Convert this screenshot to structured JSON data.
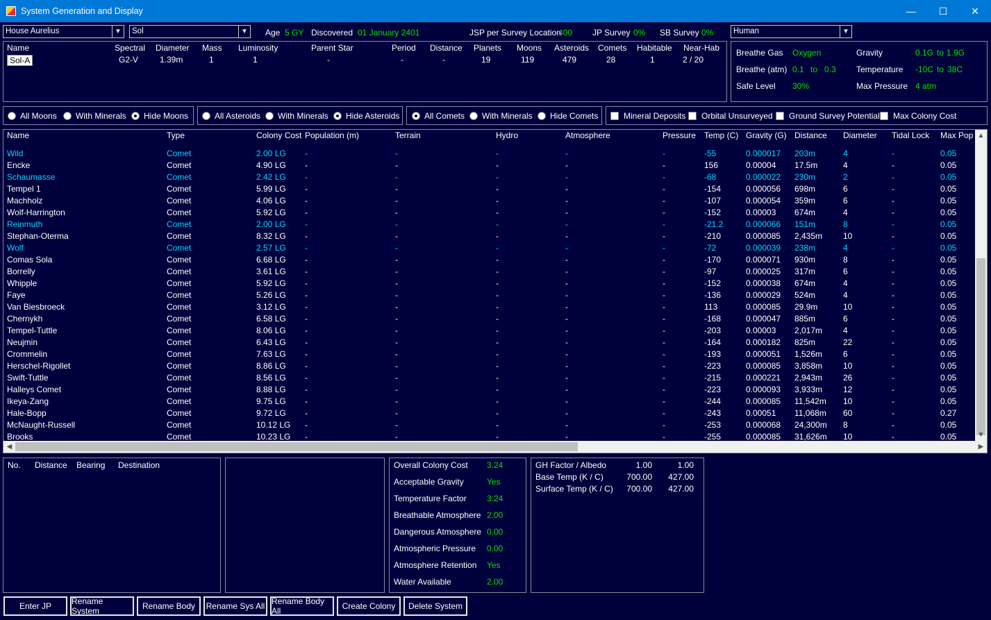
{
  "window": {
    "title": "System Generation and Display",
    "minimize": "—",
    "maximize": "☐",
    "close": "✕"
  },
  "top": {
    "race_select": "House Aurelius",
    "system_select": "Sol",
    "age_label": "Age",
    "age_value": "5 GY",
    "discovered_label": "Discovered",
    "discovered_value": "01 January 2401",
    "jsp_label": "JSP per Survey Location",
    "jsp_value": "400",
    "jp_label": "JP Survey",
    "jp_value": "0%",
    "sb_label": "SB Survey",
    "sb_value": "0%",
    "species_select": "Human"
  },
  "star": {
    "headers": [
      "Name",
      "Spectral",
      "Diameter",
      "Mass",
      "Luminosity",
      "Parent Star",
      "Period",
      "Distance",
      "Planets",
      "Moons",
      "Asteroids",
      "Comets",
      "Habitable",
      "Near-Hab"
    ],
    "values": [
      "Sol-A",
      "G2-V",
      "1.39m",
      "1",
      "1",
      "-",
      "-",
      "-",
      "19",
      "119",
      "479",
      "28",
      "1",
      "2 / 20"
    ]
  },
  "species": {
    "breathe_gas_label": "Breathe Gas",
    "breathe_gas": "Oxygen",
    "gravity_label": "Gravity",
    "gravity_min": "0.1G",
    "gravity_to": "to",
    "gravity_max": "1.9G",
    "breathe_atm_label": "Breathe (atm)",
    "breathe_min": "0.1",
    "breathe_to": "to",
    "breathe_max": "0.3",
    "temp_label": "Temperature",
    "temp_min": "-10C",
    "temp_to": "to",
    "temp_max": "38C",
    "safe_label": "Safe Level",
    "safe_value": "30%",
    "maxp_label": "Max Pressure",
    "maxp_value": "4 atm"
  },
  "filters": {
    "moons": [
      "All Moons",
      "With Minerals",
      "Hide Moons"
    ],
    "asteroids": [
      "All Asteroids",
      "With Minerals",
      "Hide Asteroids"
    ],
    "comets": [
      "All Comets",
      "With Minerals",
      "Hide Comets"
    ],
    "checks": [
      "Mineral Deposits",
      "Orbital Unsurveyed",
      "Ground Survey Potential",
      "Max Colony Cost"
    ]
  },
  "grid": {
    "headers": [
      "Name",
      "Type",
      "Colony Cost",
      "Population (m)",
      "Terrain",
      "Hydro",
      "Atmosphere",
      "Pressure",
      "Temp (C)",
      "Gravity (G)",
      "Distance",
      "Diameter",
      "Tidal Lock",
      "Max Pop"
    ],
    "rows": [
      [
        "Wild",
        "Comet",
        "2.00 LG",
        "-",
        "-",
        "-",
        "-",
        "-",
        "-55",
        "0.000017",
        "203m",
        "4",
        "-",
        "0.05",
        true
      ],
      [
        "Encke",
        "Comet",
        "4.90 LG",
        "-",
        "-",
        "-",
        "-",
        "-",
        "156",
        "0.00004",
        "17.5m",
        "4",
        "-",
        "0.05",
        false
      ],
      [
        "Schaumasse",
        "Comet",
        "2.42 LG",
        "-",
        "-",
        "-",
        "-",
        "-",
        "-68",
        "0.000022",
        "230m",
        "2",
        "-",
        "0.05",
        true
      ],
      [
        "Tempel 1",
        "Comet",
        "5.99 LG",
        "-",
        "-",
        "-",
        "-",
        "-",
        "-154",
        "0.000056",
        "698m",
        "6",
        "-",
        "0.05",
        false
      ],
      [
        "Machholz",
        "Comet",
        "4.06 LG",
        "-",
        "-",
        "-",
        "-",
        "-",
        "-107",
        "0.000054",
        "359m",
        "6",
        "-",
        "0.05",
        false
      ],
      [
        "Wolf-Harrington",
        "Comet",
        "5.92 LG",
        "-",
        "-",
        "-",
        "-",
        "-",
        "-152",
        "0.00003",
        "674m",
        "4",
        "-",
        "0.05",
        false
      ],
      [
        "Reinmuth",
        "Comet",
        "2.00 LG",
        "-",
        "-",
        "-",
        "-",
        "-",
        "-21.2",
        "0.000066",
        "151m",
        "8",
        "-",
        "0.05",
        true
      ],
      [
        "Stephan-Oterma",
        "Comet",
        "8.32 LG",
        "-",
        "-",
        "-",
        "-",
        "-",
        "-210",
        "0.000085",
        "2,435m",
        "10",
        "-",
        "0.05",
        false
      ],
      [
        "Wolf",
        "Comet",
        "2.57 LG",
        "-",
        "-",
        "-",
        "-",
        "-",
        "-72",
        "0.000039",
        "238m",
        "4",
        "-",
        "0.05",
        true
      ],
      [
        "Comas Sola",
        "Comet",
        "6.68 LG",
        "-",
        "-",
        "-",
        "-",
        "-",
        "-170",
        "0.000071",
        "930m",
        "8",
        "-",
        "0.05",
        false
      ],
      [
        "Borrelly",
        "Comet",
        "3.61 LG",
        "-",
        "-",
        "-",
        "-",
        "-",
        "-97",
        "0.000025",
        "317m",
        "6",
        "-",
        "0.05",
        false
      ],
      [
        "Whipple",
        "Comet",
        "5.92 LG",
        "-",
        "-",
        "-",
        "-",
        "-",
        "-152",
        "0.000038",
        "674m",
        "4",
        "-",
        "0.05",
        false
      ],
      [
        "Faye",
        "Comet",
        "5.26 LG",
        "-",
        "-",
        "-",
        "-",
        "-",
        "-136",
        "0.000029",
        "524m",
        "4",
        "-",
        "0.05",
        false
      ],
      [
        "Van Biesbroeck",
        "Comet",
        "3.12 LG",
        "-",
        "-",
        "-",
        "-",
        "-",
        "113",
        "0.000085",
        "29.9m",
        "10",
        "-",
        "0.05",
        false
      ],
      [
        "Chernykh",
        "Comet",
        "6.58 LG",
        "-",
        "-",
        "-",
        "-",
        "-",
        "-168",
        "0.000047",
        "885m",
        "6",
        "-",
        "0.05",
        false
      ],
      [
        "Tempel-Tuttle",
        "Comet",
        "8.06 LG",
        "-",
        "-",
        "-",
        "-",
        "-",
        "-203",
        "0.00003",
        "2,017m",
        "4",
        "-",
        "0.05",
        false
      ],
      [
        "Neujmin",
        "Comet",
        "6.43 LG",
        "-",
        "-",
        "-",
        "-",
        "-",
        "-164",
        "0.000182",
        "825m",
        "22",
        "-",
        "0.05",
        false
      ],
      [
        "Crommelin",
        "Comet",
        "7.63 LG",
        "-",
        "-",
        "-",
        "-",
        "-",
        "-193",
        "0.000051",
        "1,526m",
        "6",
        "-",
        "0.05",
        false
      ],
      [
        "Herschel-Rigollet",
        "Comet",
        "8.86 LG",
        "-",
        "-",
        "-",
        "-",
        "-",
        "-223",
        "0.000085",
        "3,858m",
        "10",
        "-",
        "0.05",
        false
      ],
      [
        "Swift-Tuttle",
        "Comet",
        "8.56 LG",
        "-",
        "-",
        "-",
        "-",
        "-",
        "-215",
        "0.000221",
        "2,943m",
        "26",
        "-",
        "0.05",
        false
      ],
      [
        "Halleys Comet",
        "Comet",
        "8.88 LG",
        "-",
        "-",
        "-",
        "-",
        "-",
        "-223",
        "0.000093",
        "3,933m",
        "12",
        "-",
        "0.05",
        false
      ],
      [
        "Ikeya-Zang",
        "Comet",
        "9.75 LG",
        "-",
        "-",
        "-",
        "-",
        "-",
        "-244",
        "0.000085",
        "11,542m",
        "10",
        "-",
        "0.05",
        false
      ],
      [
        "Hale-Bopp",
        "Comet",
        "9.72 LG",
        "-",
        "-",
        "-",
        "-",
        "-",
        "-243",
        "0.00051",
        "11,068m",
        "60",
        "-",
        "0.27",
        false
      ],
      [
        "McNaught-Russell",
        "Comet",
        "10.12 LG",
        "-",
        "-",
        "-",
        "-",
        "-",
        "-253",
        "0.000068",
        "24,300m",
        "8",
        "-",
        "0.05",
        false
      ],
      [
        "Brooks",
        "Comet",
        "10.23 LG",
        "-",
        "-",
        "-",
        "-",
        "-",
        "-255",
        "0.000085",
        "31,626m",
        "10",
        "-",
        "0.05",
        false
      ]
    ]
  },
  "jp_panel": {
    "headers": [
      "No.",
      "Distance",
      "Bearing",
      "Destination"
    ]
  },
  "colony": [
    [
      "Overall Colony Cost",
      "3.24"
    ],
    [
      "Acceptable Gravity",
      "Yes"
    ],
    [
      "Temperature Factor",
      "3.24"
    ],
    [
      "Breathable Atmosphere",
      "2.00"
    ],
    [
      "Dangerous Atmosphere",
      "0.00"
    ],
    [
      "Atmospheric Pressure",
      "0.00"
    ],
    [
      "Atmosphere Retention",
      "Yes"
    ],
    [
      "Water Available",
      "2.00"
    ]
  ],
  "temps": [
    [
      "GH Factor / Albedo",
      "1.00",
      "1.00"
    ],
    [
      "Base Temp (K / C)",
      "700.00",
      "427.00"
    ],
    [
      "Surface Temp (K / C)",
      "700.00",
      "427.00"
    ]
  ],
  "buttons": [
    "Enter JP",
    "Rename System",
    "Rename Body",
    "Rename Sys All",
    "Rename Body All",
    "Create Colony",
    "Delete System"
  ],
  "colors": {
    "background": "#00003c",
    "titlebar": "#0078d7",
    "value_green": "#00e000",
    "highlight_cyan": "#00d8ff"
  }
}
